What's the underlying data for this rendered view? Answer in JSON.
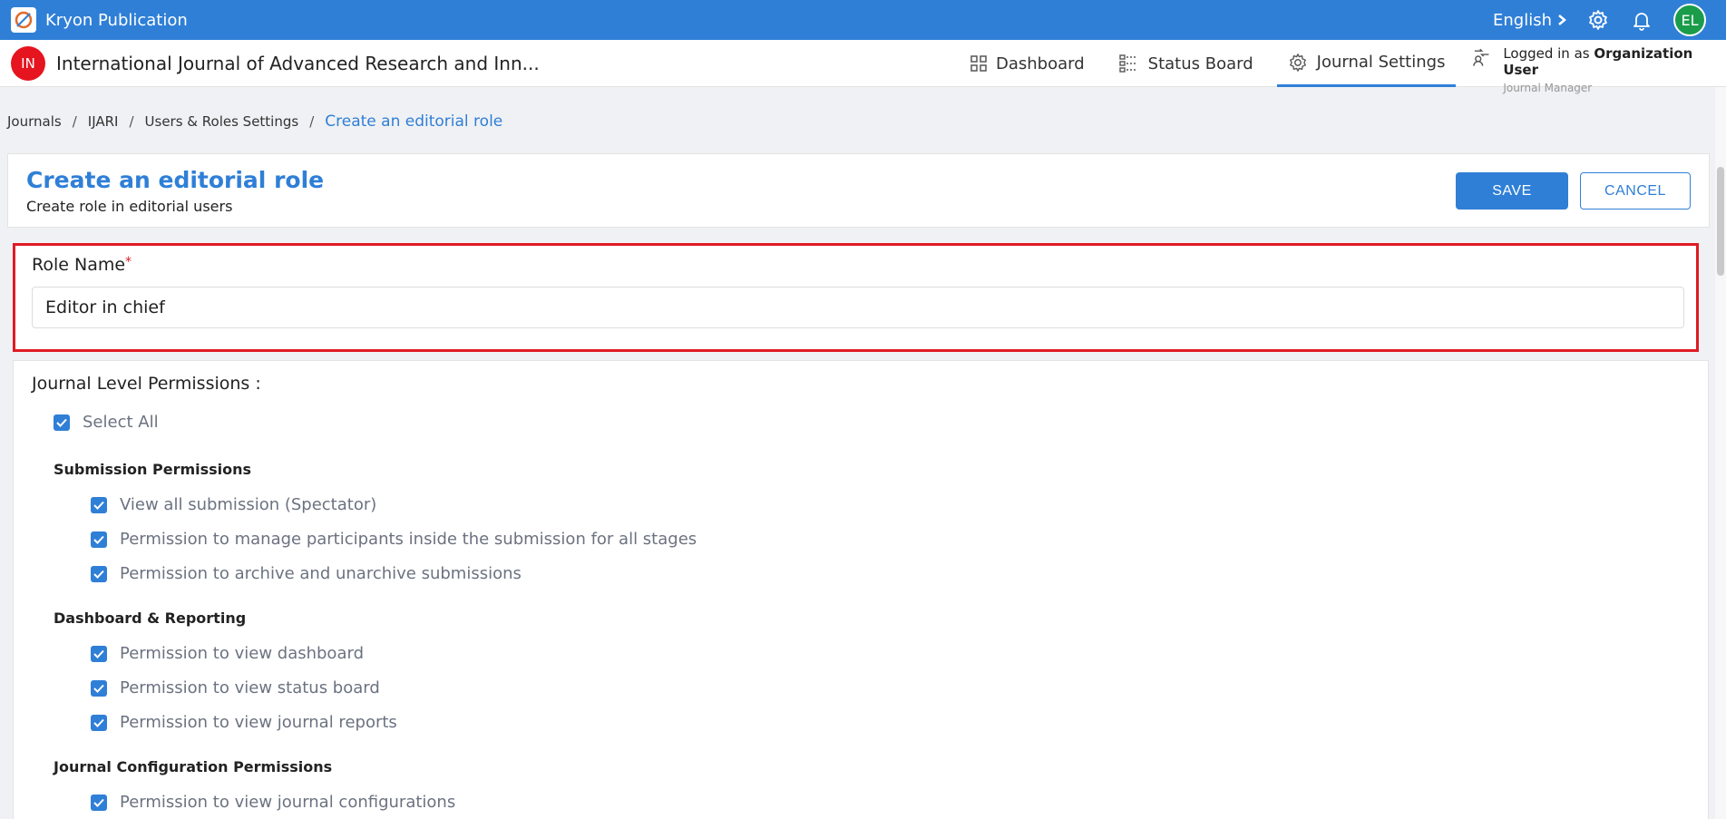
{
  "app": {
    "title": "Kryon Publication",
    "language": "English",
    "avatar_initials": "EL"
  },
  "journal": {
    "badge": "IN",
    "title": "International Journal of Advanced Research and Inn..."
  },
  "nav": {
    "dashboard": "Dashboard",
    "status_board": "Status Board",
    "journal_settings": "Journal Settings"
  },
  "login": {
    "prefix": "Logged in as",
    "user": "Organization User",
    "role": "Journal Manager"
  },
  "breadcrumb": [
    "Journals",
    "IJARI",
    "Users & Roles Settings",
    "Create an editorial role"
  ],
  "header": {
    "title": "Create an editorial role",
    "subtitle": "Create role in editorial users",
    "save": "SAVE",
    "cancel": "CANCEL"
  },
  "role": {
    "label": "Role Name",
    "required": "*",
    "value": "Editor in chief"
  },
  "permissions": {
    "title": "Journal Level Permissions :",
    "select_all": "Select All",
    "groups": [
      {
        "title": "Submission Permissions",
        "items": [
          "View all submission (Spectator)",
          "Permission to manage participants inside the submission for all stages",
          "Permission to archive and unarchive submissions"
        ]
      },
      {
        "title": "Dashboard & Reporting",
        "items": [
          "Permission to view dashboard",
          "Permission to view status board",
          "Permission to view journal reports"
        ]
      },
      {
        "title": "Journal Configuration Permissions",
        "items": [
          "Permission to view journal configurations"
        ]
      }
    ]
  },
  "colors": {
    "primary": "#2f7fd7",
    "highlight": "#e01b24"
  }
}
